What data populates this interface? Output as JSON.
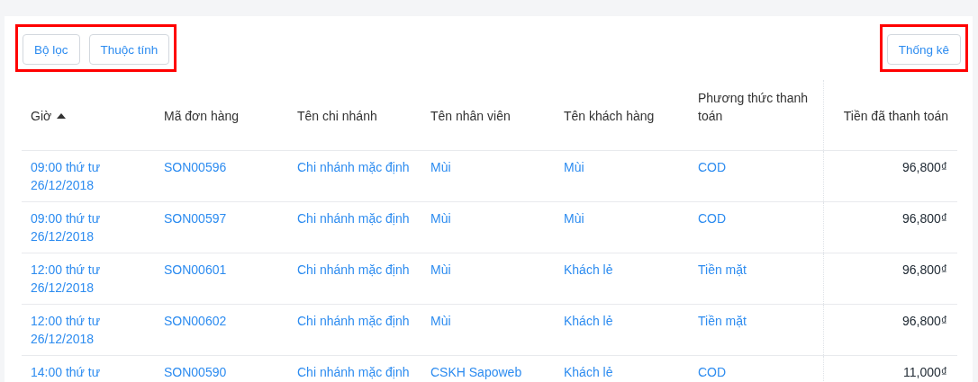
{
  "toolbar": {
    "groups": [
      {
        "highlighted": true,
        "buttons": [
          {
            "label": "Bộ lọc"
          },
          {
            "label": "Thuộc tính"
          }
        ]
      },
      {
        "highlighted": true,
        "buttons": [
          {
            "label": "Thống kê"
          }
        ]
      }
    ]
  },
  "table": {
    "columns": [
      {
        "label": "Giờ",
        "sorted": true
      },
      {
        "label": "Mã đơn hàng",
        "sorted": false
      },
      {
        "label": "Tên chi nhánh",
        "sorted": false
      },
      {
        "label": "Tên nhân viên",
        "sorted": false
      },
      {
        "label": "Tên khách hàng",
        "sorted": false
      },
      {
        "label": "Phương thức thanh toán",
        "sorted": false
      },
      {
        "label": "Tiền đã thanh toán",
        "sorted": false
      }
    ],
    "rows": [
      {
        "time": "09:00 thứ tư",
        "date": "26/12/2018",
        "order": "SON00596",
        "branch": "Chi nhánh mặc định",
        "staff": "Mùi",
        "customer": "Mùi",
        "payment": "COD",
        "amount": "96,800₫"
      },
      {
        "time": "09:00 thứ tư",
        "date": "26/12/2018",
        "order": "SON00597",
        "branch": "Chi nhánh mặc định",
        "staff": "Mùi",
        "customer": "Mùi",
        "payment": "COD",
        "amount": "96,800₫"
      },
      {
        "time": "12:00 thứ tư",
        "date": "26/12/2018",
        "order": "SON00601",
        "branch": "Chi nhánh mặc định",
        "staff": "Mùi",
        "customer": "Khách lẻ",
        "payment": "Tiền mặt",
        "amount": "96,800₫"
      },
      {
        "time": "12:00 thứ tư",
        "date": "26/12/2018",
        "order": "SON00602",
        "branch": "Chi nhánh mặc định",
        "staff": "Mùi",
        "customer": "Khách lẻ",
        "payment": "Tiền mặt",
        "amount": "96,800₫"
      },
      {
        "time": "14:00 thứ tư",
        "order": "SON00590",
        "branch": "Chi nhánh mặc định",
        "staff": "CSKH Sapoweb",
        "customer": "Khách lẻ",
        "payment": "COD",
        "amount": "11,000₫"
      }
    ]
  }
}
